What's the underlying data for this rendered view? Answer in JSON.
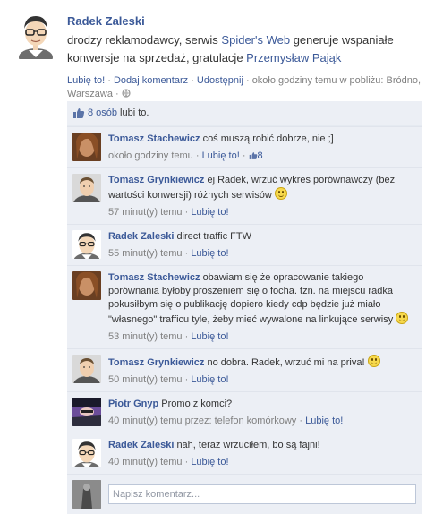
{
  "post": {
    "author": "Radek Zaleski",
    "text_part1": "drodzy reklamodawcy, serwis ",
    "link1": "Spider's Web",
    "text_part2": " generuje wspaniałe konwersje na sprzedaż, gratulacje ",
    "link2": "Przemysław Pająk",
    "actions": {
      "like": "Lubię to!",
      "comment": "Dodaj komentarz",
      "share": "Udostępnij",
      "sep": " · "
    },
    "meta_text": "około godziny temu w pobliżu: Bródno, Warszawa",
    "location_icon": "globe-icon"
  },
  "likes": {
    "count_text": "8 osób",
    "suffix": " lubi to."
  },
  "comments": [
    {
      "author": "Tomasz Stachewicz",
      "text": "coś muszą robić dobrze, nie ;]",
      "time": "około godziny temu",
      "like": "Lubię to!",
      "likes_count": "8"
    },
    {
      "author": "Tomasz Grynkiewicz",
      "text": "ej Radek, wrzuć wykres porównawczy (bez wartości konwersji) różnych serwisów",
      "time": "57 minut(y) temu",
      "like": "Lubię to!"
    },
    {
      "author": "Radek Zaleski",
      "text": "direct traffic FTW",
      "time": "55 minut(y) temu",
      "like": "Lubię to!"
    },
    {
      "author": "Tomasz Stachewicz",
      "text": "obawiam się że opracowanie takiego porównania byłoby proszeniem się o focha. tzn. na miejscu radka pokusiłbym się o publikację dopiero kiedy cdp będzie już miało \"własnego\" trafficu tyle, żeby mieć wywalone na linkujące serwisy",
      "time": "53 minut(y) temu",
      "like": "Lubię to!"
    },
    {
      "author": "Tomasz Grynkiewicz",
      "text": "no dobra. Radek, wrzuć mi na priva!",
      "time": "50 minut(y) temu",
      "like": "Lubię to!"
    },
    {
      "author": "Piotr Gnyp",
      "text": "Promo z komci?",
      "time": "40 minut(y) temu przez: telefon komórkowy",
      "like": "Lubię to!"
    },
    {
      "author": "Radek Zaleski",
      "text": "nah, teraz wrzuciłem, bo są fajni!",
      "time": "40 minut(y) temu",
      "like": "Lubię to!"
    }
  ],
  "comment_input": {
    "placeholder": "Napisz komentarz..."
  },
  "colors": {
    "link": "#3b5998",
    "panel": "#eceff5",
    "muted": "#808080"
  }
}
